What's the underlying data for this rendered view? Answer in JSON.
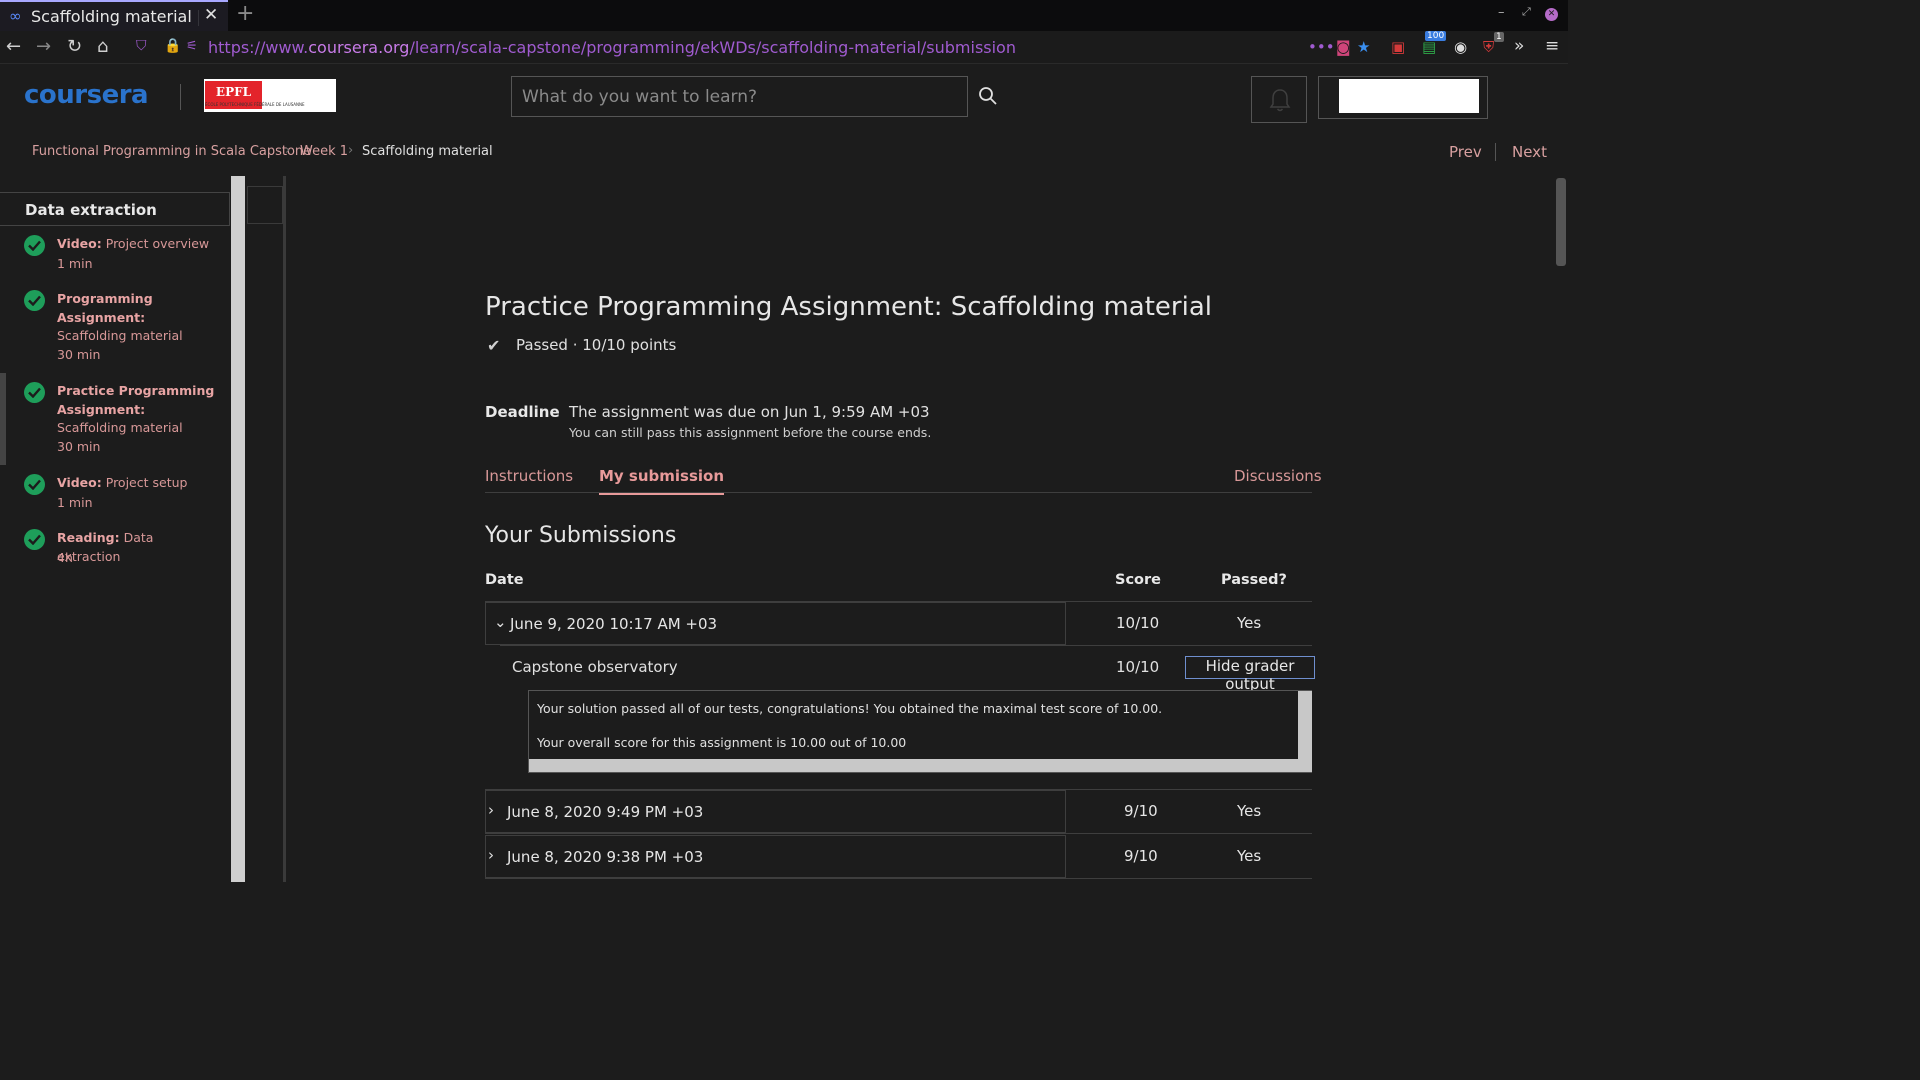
{
  "browser": {
    "tab_title": "Scaffolding material | C",
    "tab_favicon": "∞",
    "new_tab_label": "+",
    "url_prefix": "https://www.",
    "url_domain": "coursera.org",
    "url_path": "/learn/scala-capstone/programming/ekWDs/scaffolding-material/submission",
    "more_label": "•••",
    "extension_badge_1": "100",
    "extension_badge_2": "1"
  },
  "header": {
    "logo_text": "coursera",
    "partner_logo_text": "EPFL",
    "partner_logo_subtext": "ÉCOLE POLYTECHNIQUE FÉDÉRALE DE LAUSANNE",
    "search_placeholder": "What do you want to learn?"
  },
  "breadcrumb": {
    "items": [
      "Functional Programming in Scala Capstone",
      "Week 1",
      "Scaffolding material"
    ],
    "separator": "›",
    "prev_label": "Prev",
    "next_label": "Next"
  },
  "sidebar": {
    "title": "Data extraction",
    "items": [
      {
        "kind": "Video:",
        "name": "Project overview",
        "duration": "1 min"
      },
      {
        "kind": "Programming Assignment:",
        "name": "Scaffolding material",
        "duration": "30 min"
      },
      {
        "kind": "Practice Programming Assignment:",
        "name": "Scaffolding material",
        "duration": "30 min"
      },
      {
        "kind": "Video:",
        "name": "Project setup",
        "duration": "1 min"
      },
      {
        "kind": "Reading:",
        "name": "Data extraction",
        "duration": "4h"
      }
    ]
  },
  "main": {
    "title": "Practice Programming Assignment: Scaffolding material",
    "status": "Passed · 10/10 points",
    "deadline_label": "Deadline",
    "deadline_text": "The assignment was due on Jun 1, 9:59 AM +03",
    "deadline_subtext": "You can still pass this assignment before the course ends.",
    "tabs": {
      "instructions": "Instructions",
      "my_submission": "My submission",
      "discussions": "Discussions"
    },
    "submissions_title": "Your Submissions",
    "columns": {
      "date": "Date",
      "score": "Score",
      "passed": "Passed?"
    },
    "submissions": [
      {
        "date": "June 9, 2020 10:17 AM +03",
        "score": "10/10",
        "passed": "Yes",
        "expanded": true
      },
      {
        "date": "June 8, 2020 9:49 PM +03",
        "score": "9/10",
        "passed": "Yes",
        "expanded": false
      },
      {
        "date": "June 8, 2020 9:38 PM +03",
        "score": "9/10",
        "passed": "Yes",
        "expanded": false
      }
    ],
    "part": {
      "name": "Capstone observatory",
      "score": "10/10",
      "hide_label": "Hide grader output",
      "grader_output_line1": "Your solution passed all of our tests, congratulations! You obtained the maximal test score of 10.00.",
      "grader_output_line2": "Your overall score for this assignment is 10.00 out of 10.00"
    }
  },
  "colors": {
    "background": "#1c1c1c",
    "link": "#d89898",
    "brand": "#2a73cc",
    "success": "#1e9e5a",
    "url": "#a05bd0"
  }
}
